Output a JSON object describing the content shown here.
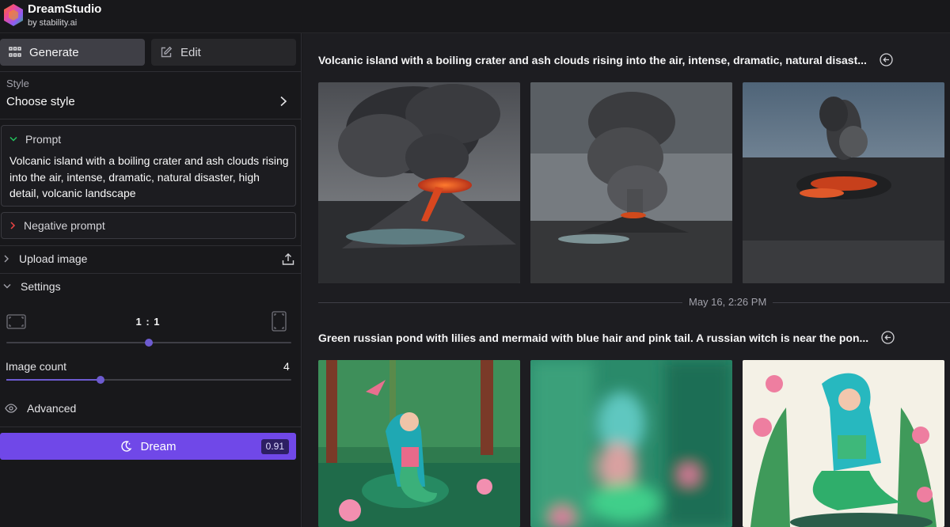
{
  "app": {
    "name": "DreamStudio",
    "byline": "by stability.ai"
  },
  "tabs": [
    {
      "label": "Generate",
      "icon": "grid-icon",
      "active": true
    },
    {
      "label": "Edit",
      "icon": "pencil-square-icon",
      "active": false
    }
  ],
  "style": {
    "label": "Style",
    "value": "Choose style"
  },
  "prompt": {
    "label": "Prompt",
    "text": "Volcanic island with a boiling crater and ash clouds rising into the air, intense, dramatic, natural disaster, high detail, volcanic landscape"
  },
  "negative_prompt": {
    "label": "Negative prompt"
  },
  "upload": {
    "label": "Upload image"
  },
  "settings": {
    "label": "Settings",
    "aspect_ratio": "1 : 1",
    "aspect_ratio_slider": 0.5,
    "image_count_label": "Image count",
    "image_count": "4",
    "image_count_slider": 0.33,
    "advanced_label": "Advanced"
  },
  "dream": {
    "label": "Dream",
    "cost": "0.91"
  },
  "generations": [
    {
      "title": "Volcanic island with a boiling crater and ash clouds rising into the air, intense, dramatic, natural disast...",
      "images": [
        "volcano-1",
        "volcano-2",
        "volcano-3"
      ]
    },
    {
      "title": "Green russian pond with lilies and mermaid with blue hair and pink tail. A russian witch is near the pon...",
      "images": [
        "mermaid-1",
        "mermaid-2",
        "mermaid-3"
      ]
    }
  ],
  "timestamp": "May 16, 2:26 PM",
  "colors": {
    "accent": "#7048e8",
    "background": "#18181b",
    "panel": "#1d1d21"
  }
}
